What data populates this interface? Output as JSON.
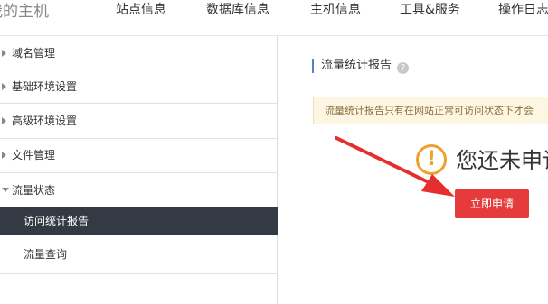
{
  "header": {
    "brand": "我的主机",
    "nav": [
      "站点信息",
      "数据库信息",
      "主机信息",
      "工具&服务",
      "操作日志"
    ]
  },
  "sidebar": {
    "items": [
      {
        "label": "域名管理"
      },
      {
        "label": "基础环境设置"
      },
      {
        "label": "高级环境设置"
      },
      {
        "label": "文件管理"
      },
      {
        "label": "流量状态"
      },
      {
        "label": "访问统计报告"
      },
      {
        "label": "流量查询"
      }
    ]
  },
  "main": {
    "section_title": "流量统计报告",
    "help_glyph": "?",
    "notice": "流量统计报告只有在网站正常可访问状态下才会",
    "status_text": "您还未申请",
    "warn_glyph": "!",
    "apply_button": "立即申请"
  },
  "colors": {
    "accent_red": "#e63b3b",
    "arrow_red": "#e62e2e",
    "active_bg": "#333a44",
    "warning": "#f0a030",
    "title_bar": "#5b7fc7"
  },
  "icons": {
    "warning": "exclamation-circle-icon",
    "help": "question-circle-icon",
    "collapsed": "caret-right-icon",
    "expanded": "caret-down-icon"
  }
}
